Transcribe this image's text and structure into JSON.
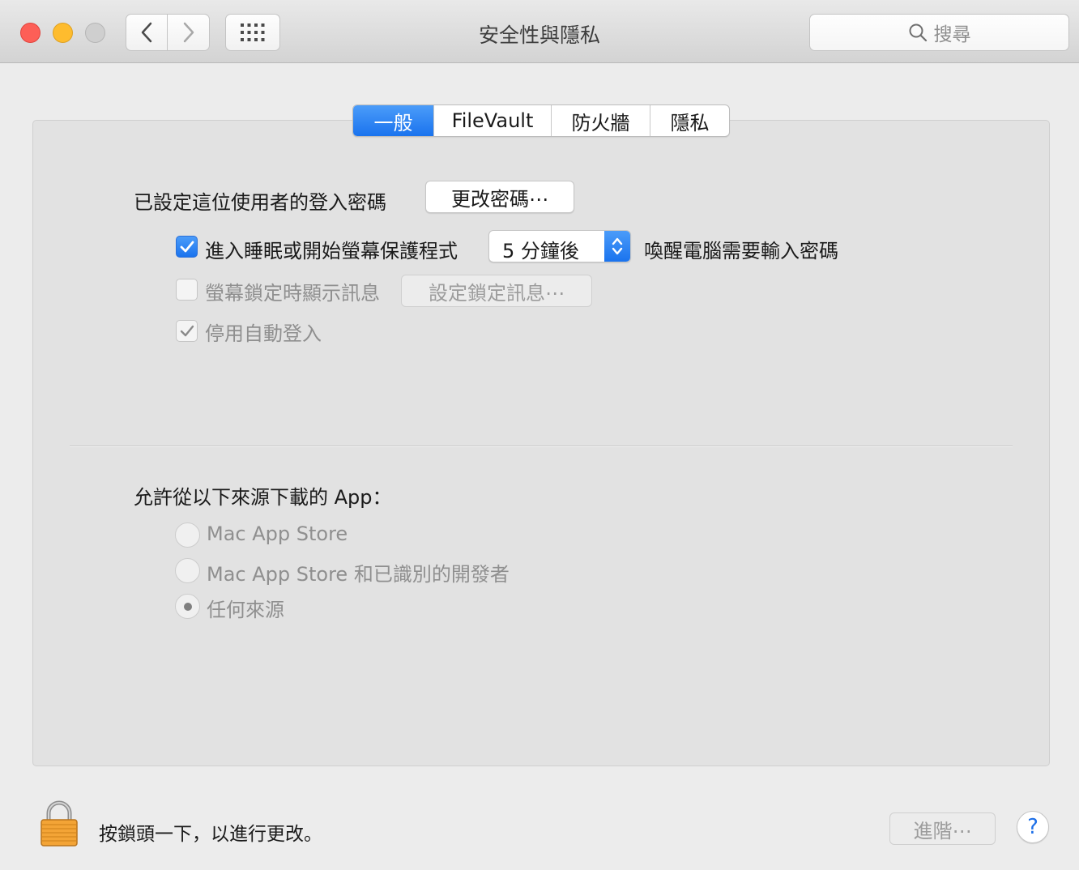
{
  "window": {
    "title": "安全性與隱私",
    "search_placeholder": "搜尋"
  },
  "tabs": [
    {
      "label": "一般",
      "active": true
    },
    {
      "label": "FileVault",
      "active": false
    },
    {
      "label": "防火牆",
      "active": false
    },
    {
      "label": "隱私",
      "active": false
    }
  ],
  "general": {
    "password_label": "已設定這位使用者的登入密碼",
    "change_password_button": "更改密碼⋯",
    "sleep_checkbox_label": "進入睡眠或開始螢幕保護程式",
    "sleep_checked": true,
    "delay_value": "5 分鐘後",
    "wake_label": "喚醒電腦需要輸入密碼",
    "lock_message_label": "螢幕鎖定時顯示訊息",
    "lock_message_checked": false,
    "set_lock_message_button": "設定鎖定訊息⋯",
    "disable_autologin_label": "停用自動登入",
    "disable_autologin_checked": true
  },
  "downloads": {
    "heading": "允許從以下來源下載的 App：",
    "options": [
      {
        "label": "Mac App Store",
        "selected": false
      },
      {
        "label": "Mac App Store 和已識別的開發者",
        "selected": false
      },
      {
        "label": "任何來源",
        "selected": true
      }
    ]
  },
  "footer": {
    "lock_text": "按鎖頭一下，以進行更改。",
    "advanced_button": "進階⋯",
    "help_button": "?"
  },
  "colors": {
    "accent": "#1a73ee",
    "traffic_red": "#fd5f57",
    "traffic_yellow": "#febc2e"
  }
}
